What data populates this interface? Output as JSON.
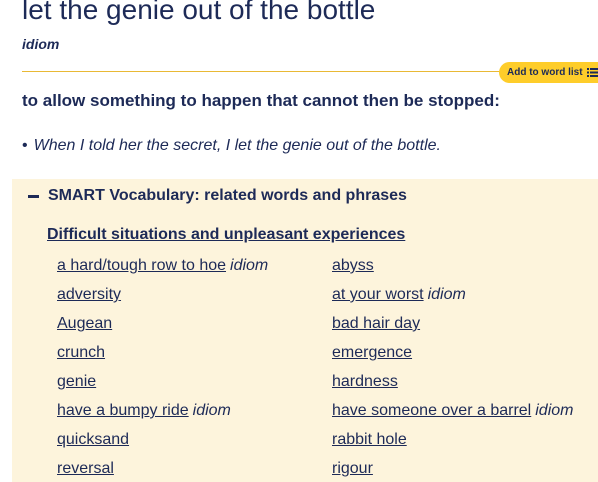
{
  "entry": {
    "headword": "let the genie out of the bottle",
    "pos": "idiom",
    "add_to_word_list": "Add to word list",
    "definition": "to allow something to happen that cannot then be stopped:",
    "example_bullet": "•",
    "example": "When I told her the secret, I let the genie out of the bottle."
  },
  "smart_vocab": {
    "title": "SMART Vocabulary: related words and phrases",
    "topic": "Difficult situations and unpleasant experiences",
    "left_column": [
      {
        "word": "a hard/tough row to hoe",
        "tag": "idiom"
      },
      {
        "word": "adversity",
        "tag": ""
      },
      {
        "word": "Augean",
        "tag": ""
      },
      {
        "word": "crunch",
        "tag": ""
      },
      {
        "word": "genie",
        "tag": ""
      },
      {
        "word": "have a bumpy ride",
        "tag": "idiom"
      },
      {
        "word": "quicksand",
        "tag": ""
      },
      {
        "word": "reversal",
        "tag": ""
      }
    ],
    "right_column": [
      {
        "word": "abyss",
        "tag": ""
      },
      {
        "word": "at your worst",
        "tag": "idiom"
      },
      {
        "word": "bad hair day",
        "tag": ""
      },
      {
        "word": "emergence",
        "tag": ""
      },
      {
        "word": "hardness",
        "tag": ""
      },
      {
        "word": "have someone over a barrel",
        "tag": "idiom"
      },
      {
        "word": "rabbit hole",
        "tag": ""
      },
      {
        "word": "rigour",
        "tag": ""
      }
    ]
  },
  "colors": {
    "text": "#1d2a57",
    "accent_yellow": "#fecd2a",
    "box_background": "#fdf4dc",
    "rule": "#e9b935"
  },
  "icons": {
    "word_list": "list-icon",
    "collapse": "minus-icon"
  }
}
